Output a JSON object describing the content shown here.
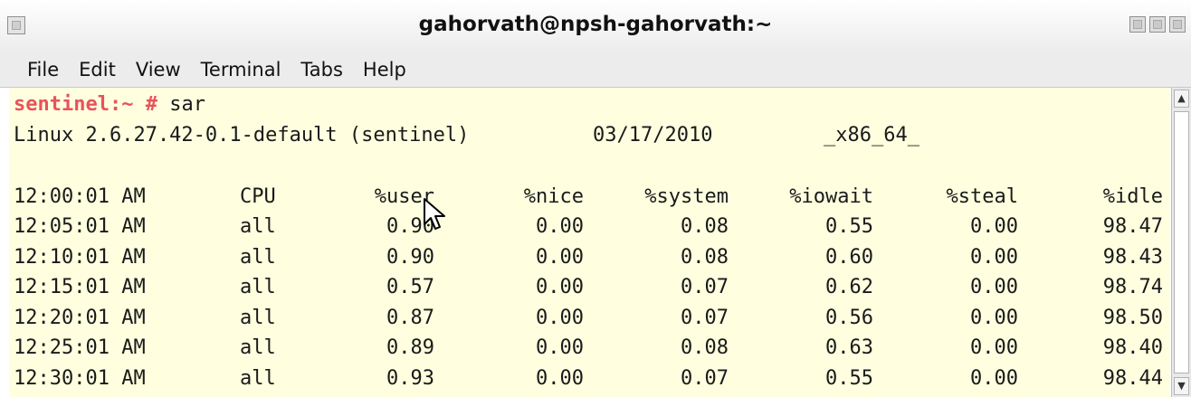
{
  "window": {
    "title": "gahorvath@npsh-gahorvath:~",
    "menu": [
      "File",
      "Edit",
      "View",
      "Terminal",
      "Tabs",
      "Help"
    ]
  },
  "terminal": {
    "prompt_host": "sentinel:~ #",
    "command": "sar",
    "sysinfo": {
      "kernel": "Linux 2.6.27.42-0.1-default (sentinel)",
      "date": "03/17/2010",
      "arch": "_x86_64_"
    },
    "header": [
      "12:00:01 AM",
      "CPU",
      "%user",
      "%nice",
      "%system",
      "%iowait",
      "%steal",
      "%idle"
    ],
    "rows": [
      [
        "12:05:01 AM",
        "all",
        "0.90",
        "0.00",
        "0.08",
        "0.55",
        "0.00",
        "98.47"
      ],
      [
        "12:10:01 AM",
        "all",
        "0.90",
        "0.00",
        "0.08",
        "0.60",
        "0.00",
        "98.43"
      ],
      [
        "12:15:01 AM",
        "all",
        "0.57",
        "0.00",
        "0.07",
        "0.62",
        "0.00",
        "98.74"
      ],
      [
        "12:20:01 AM",
        "all",
        "0.87",
        "0.00",
        "0.07",
        "0.56",
        "0.00",
        "98.50"
      ],
      [
        "12:25:01 AM",
        "all",
        "0.89",
        "0.00",
        "0.08",
        "0.63",
        "0.00",
        "98.40"
      ],
      [
        "12:30:01 AM",
        "all",
        "0.93",
        "0.00",
        "0.07",
        "0.55",
        "0.00",
        "98.44"
      ]
    ]
  },
  "icons": {
    "window_menu": "window-menu-icon",
    "minimize": "minimize-icon",
    "maximize": "maximize-icon",
    "close": "close-icon",
    "scroll_up": "arrow-up-icon",
    "scroll_down": "arrow-down-icon",
    "pointer": "mouse-pointer-icon"
  },
  "colors": {
    "terminal_bg": "#ffffe0",
    "prompt": "#e8535c"
  }
}
